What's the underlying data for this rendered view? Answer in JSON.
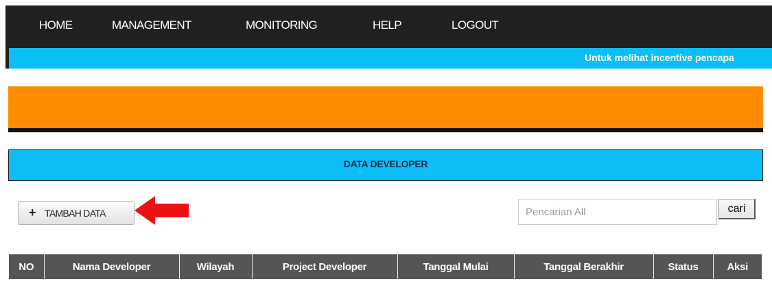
{
  "nav": {
    "items": [
      {
        "label": "HOME"
      },
      {
        "label": "MANAGEMENT"
      },
      {
        "label": "MONITORING"
      },
      {
        "label": "HELP"
      },
      {
        "label": "LOGOUT"
      }
    ]
  },
  "marquee": {
    "text": "Untuk melihat incentive pencapa"
  },
  "section": {
    "title": "DATA DEVELOPER"
  },
  "toolbar": {
    "add_icon": "+",
    "add_label": "TAMBAH DATA",
    "search_placeholder": "Pencarian All",
    "search_button": "cari"
  },
  "table": {
    "columns": [
      "NO",
      "Nama Developer",
      "Wilayah",
      "Project Developer",
      "Tanggal Mulai",
      "Tanggal Berakhir",
      "Status",
      "Aksi"
    ]
  },
  "colors": {
    "nav_bg": "#202020",
    "accent_blue": "#0bbef5",
    "banner_orange": "#ff8c00",
    "table_header": "#555555",
    "arrow_red": "#ee1111"
  },
  "icons": {
    "add": "plus-icon",
    "annotation": "red-arrow-icon"
  }
}
